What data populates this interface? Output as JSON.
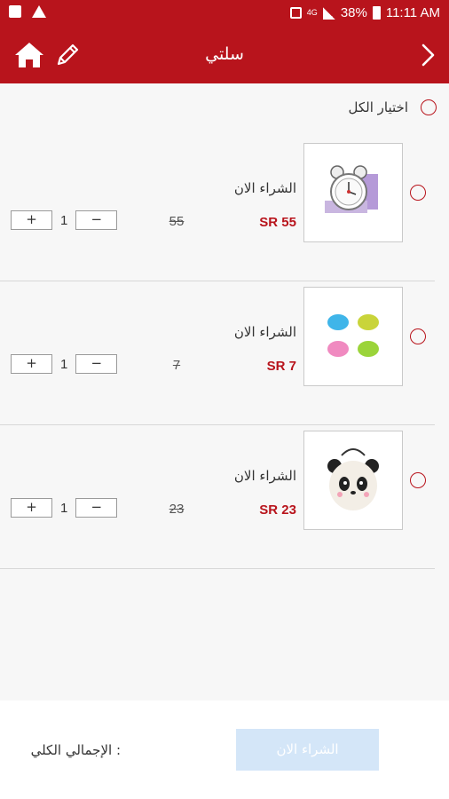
{
  "status_bar": {
    "battery": "38%",
    "time": "11:11 AM",
    "network": "4G"
  },
  "app_bar": {
    "title": "سلتي"
  },
  "select_all": {
    "label": "اختيار الكل"
  },
  "items": [
    {
      "buy_label": "الشراء الان",
      "price": "SR 55",
      "old_price": "55",
      "quantity": "1",
      "image": "alarm-clock"
    },
    {
      "buy_label": "الشراء الان",
      "price": "SR 7",
      "old_price": "7",
      "quantity": "1",
      "image": "colored-erasers"
    },
    {
      "buy_label": "الشراء الان",
      "price": "SR 23",
      "old_price": "23",
      "quantity": "1",
      "image": "panda-bag"
    }
  ],
  "stepper": {
    "plus": "+",
    "minus": "−"
  },
  "footer": {
    "total_label": "الإجمالي الكلي :",
    "buy_button": "الشراء الان"
  },
  "colors": {
    "primary": "#b8141c",
    "button_disabled": "#d4e6f8"
  }
}
